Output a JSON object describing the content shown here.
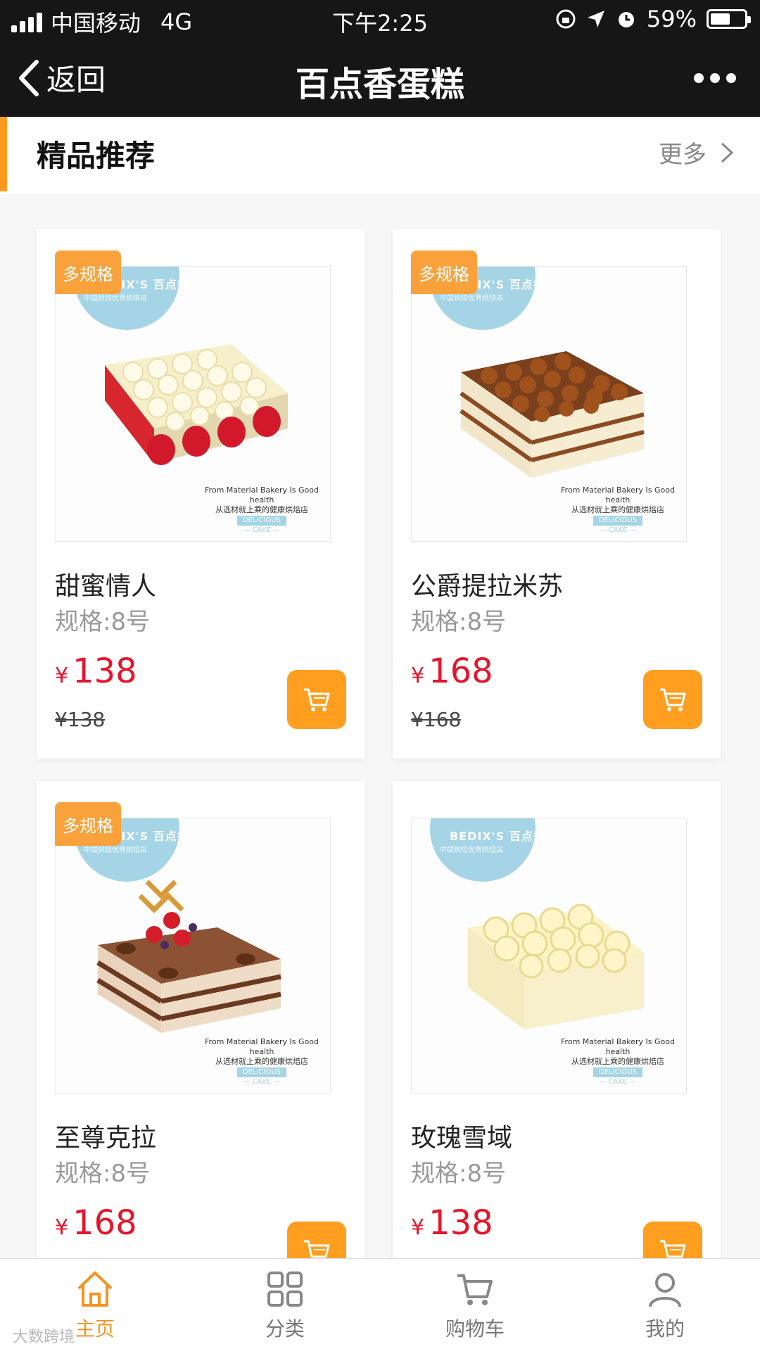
{
  "status_bar": {
    "carrier": "中国移动",
    "network": "4G",
    "time": "下午2:25",
    "battery": "59%",
    "battery_level": 0.59
  },
  "nav": {
    "back_label": "返回",
    "title": "百点香蛋糕"
  },
  "section": {
    "title": "精品推荐",
    "more_label": "更多"
  },
  "products": [
    {
      "badge": "多规格",
      "name": "甜蜜情人",
      "spec": "规格:8号",
      "currency": "¥",
      "price": "138",
      "original_price": "¥138"
    },
    {
      "badge": "多规格",
      "name": "公爵提拉米苏",
      "spec": "规格:8号",
      "currency": "¥",
      "price": "168",
      "original_price": "¥168"
    },
    {
      "badge": "多规格",
      "name": "至尊克拉",
      "spec": "规格:8号",
      "currency": "¥",
      "price": "168",
      "original_price": ""
    },
    {
      "badge": "",
      "name": "玫瑰雪域",
      "spec": "规格:8号",
      "currency": "¥",
      "price": "138",
      "original_price": ""
    }
  ],
  "image_text": {
    "brand": "BEDIX'S 百点香",
    "brand_sub": "中国烘焙优秀烘焙店",
    "caption_en": "From Material Bakery Is Good health",
    "caption_cn": "从选材就上乘的健康烘焙店",
    "caption_tag": "DELICIOUS",
    "caption_cake": "— CAKE —"
  },
  "tabs": [
    {
      "label": "主页",
      "icon": "home-icon",
      "active": true
    },
    {
      "label": "分类",
      "icon": "grid-icon",
      "active": false
    },
    {
      "label": "购物车",
      "icon": "cart-icon",
      "active": false
    },
    {
      "label": "我的",
      "icon": "user-icon",
      "active": false
    }
  ],
  "watermark": "大数跨境",
  "colors": {
    "accent": "#ff9e1f",
    "price": "#e4162c",
    "brand_blue": "#a4d4e6",
    "header_bg": "#161616"
  }
}
